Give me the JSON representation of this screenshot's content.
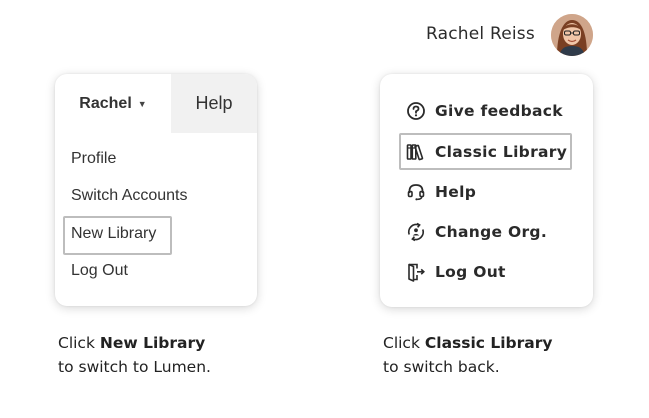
{
  "header": {
    "user_name": "Rachel Reiss"
  },
  "old_menu": {
    "user_tab": "Rachel",
    "help_tab": "Help",
    "items": [
      "Profile",
      "Switch Accounts",
      "New Library",
      "Log Out"
    ]
  },
  "new_menu": {
    "items": [
      {
        "label": "Give feedback",
        "icon": "question-circle-icon"
      },
      {
        "label": "Classic Library",
        "icon": "books-icon"
      },
      {
        "label": "Help",
        "icon": "headset-icon"
      },
      {
        "label": "Change Org.",
        "icon": "switch-org-icon"
      },
      {
        "label": "Log Out",
        "icon": "door-exit-icon"
      }
    ]
  },
  "captions": {
    "left": {
      "pre": "Click ",
      "bold": "New Library",
      "post": "to switch to Lumen."
    },
    "right": {
      "pre": "Click ",
      "bold": "Classic Library",
      "post": "to switch back."
    }
  },
  "colors": {
    "highlight_border": "#bdbdbd",
    "help_tab_bg": "#f1f1f1",
    "text": "#2a2a2a"
  }
}
